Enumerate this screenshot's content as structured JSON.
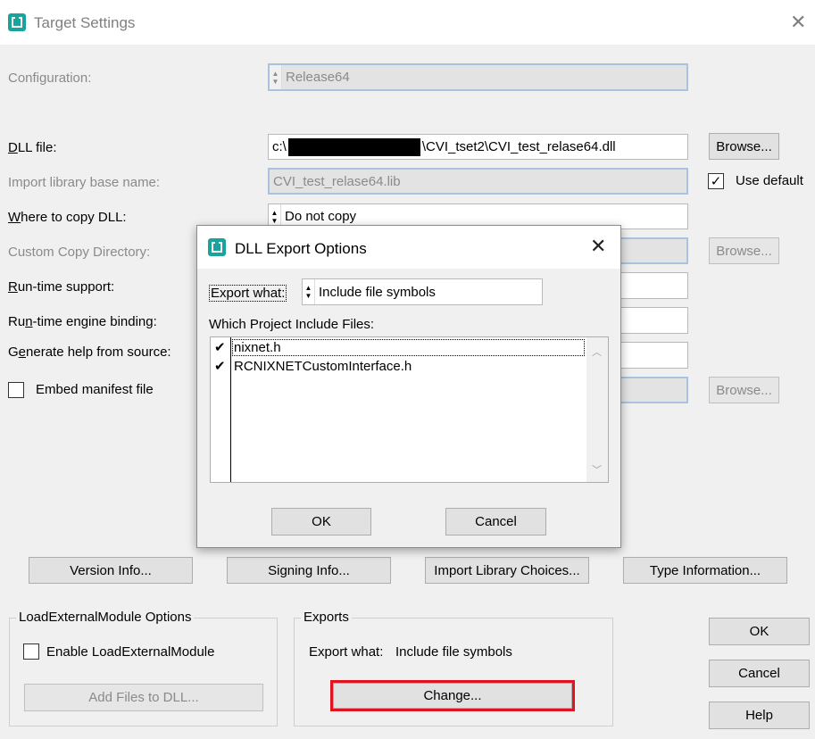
{
  "window": {
    "title": "Target Settings",
    "close_glyph": "✕",
    "icon": "cvi-app-icon"
  },
  "form": {
    "configuration_label": "Configuration:",
    "configuration_value": "Release64",
    "dll_file_label": "DLL file:",
    "dll_file_prefix": "c:\\",
    "dll_file_suffix": "\\CVI_tset2\\CVI_test_relase64.dll",
    "browse_label": "Browse...",
    "import_lib_label": "Import library base name:",
    "import_lib_value": "CVI_test_relase64.lib",
    "use_default_label": "Use default",
    "use_default_checked": true,
    "where_copy_label": "Where to copy DLL:",
    "where_copy_value": "Do not copy",
    "custom_copy_label": "Custom Copy Directory:",
    "runtime_support_label": "Run-time support:",
    "runtime_engine_label": "Run-time engine binding:",
    "generate_help_label": "Generate help from source:",
    "embed_manifest_label": "Embed manifest file",
    "embed_manifest_checked": false
  },
  "buttons": {
    "version_info": "Version Info...",
    "signing_info": "Signing Info...",
    "import_library_choices": "Import Library Choices...",
    "type_information": "Type Information...",
    "ok": "OK",
    "cancel": "Cancel",
    "help": "Help"
  },
  "load_external": {
    "title": "LoadExternalModule Options",
    "enable_label": "Enable LoadExternalModule",
    "enable_checked": false,
    "add_files_label": "Add Files to DLL..."
  },
  "exports": {
    "title": "Exports",
    "export_what_label": "Export what:",
    "export_what_value": "Include file symbols",
    "change_label": "Change..."
  },
  "export_dialog": {
    "title": "DLL Export Options",
    "close_glyph": "✕",
    "export_what_label": "Export what:",
    "export_what_value": "Include file symbols",
    "include_files_label": "Which Project Include Files:",
    "files": [
      {
        "name": "nixnet.h",
        "checked": true
      },
      {
        "name": "RCNIXNETCustomInterface.h",
        "checked": true
      }
    ],
    "check_glyph": "✔",
    "ok_label": "OK",
    "cancel_label": "Cancel"
  },
  "colors": {
    "accent_teal": "#1aa39b",
    "highlight_red": "#e0141e",
    "disabled_field_border": "#a9c3de"
  }
}
